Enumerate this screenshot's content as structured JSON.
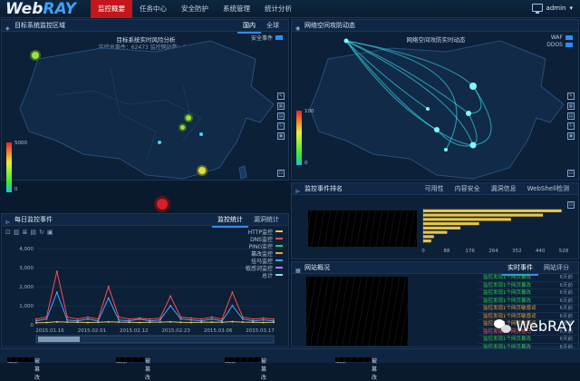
{
  "brand": {
    "web": "Web",
    "ray": "RAY"
  },
  "nav": [
    {
      "label": "监控概要",
      "active": true
    },
    {
      "label": "任务中心"
    },
    {
      "label": "安全防护"
    },
    {
      "label": "系统管理"
    },
    {
      "label": "统计分析"
    }
  ],
  "user": {
    "name": "admin"
  },
  "map_panel": {
    "title": "目标系统监控区域",
    "tabs": [
      {
        "label": "国内",
        "active": true
      },
      {
        "label": "全球"
      }
    ],
    "subtitle": "目标系统实时风险分析",
    "stats": "监控总事件：62473    监控网站数：305",
    "legend": "安全事件",
    "scale_max": "5000",
    "scale_min": "0",
    "legend_color": "#2f8cff"
  },
  "attack_panel": {
    "title": "网络空间攻防动态",
    "subtitle": "网络空间攻防实时动态",
    "legend": [
      {
        "label": "WAF",
        "color": "#2f8cff"
      },
      {
        "label": "DDOS",
        "color": "#2f8cff"
      }
    ],
    "scale_max": "100",
    "scale_min": "0"
  },
  "daily_panel": {
    "title": "每日监控事件",
    "tabs": [
      {
        "label": "监控统计",
        "active": true
      },
      {
        "label": "漏洞统计"
      }
    ],
    "legend": [
      "HTTP监控",
      "DNS监控",
      "PING监控",
      "篡改监控",
      "挂马监控",
      "敏感词监控",
      "总计"
    ],
    "chart_data": {
      "type": "line",
      "y_ticks": [
        "4,000",
        "3,000",
        "2,000",
        "1,000",
        "0"
      ],
      "ylim": [
        0,
        4000
      ],
      "x_ticks": [
        "2015.01.16",
        "2015.02.01",
        "2015.02.12",
        "2015.02.23",
        "2015.03.06",
        "2015.03.17"
      ],
      "series": [
        {
          "name": "HTTP监控",
          "color": "#4aa3ff",
          "values": [
            200,
            300,
            1700,
            250,
            200,
            300,
            200,
            1400,
            250,
            200,
            300,
            200,
            250,
            1000,
            300,
            250,
            200,
            300,
            200,
            1000,
            300,
            200,
            250,
            200
          ]
        },
        {
          "name": "DNS监控",
          "color": "#ff4d4d",
          "values": [
            300,
            400,
            2800,
            400,
            300,
            400,
            300,
            2000,
            400,
            300,
            350,
            300,
            350,
            1500,
            400,
            350,
            300,
            400,
            300,
            1700,
            400,
            300,
            350,
            300
          ]
        },
        {
          "name": "总计",
          "color": "#e8c548",
          "values": [
            100,
            120,
            150,
            140,
            130,
            120,
            130,
            150,
            140,
            130,
            120,
            130,
            140,
            150,
            130,
            120,
            130,
            140,
            130,
            160,
            140,
            130,
            120,
            130
          ]
        }
      ]
    }
  },
  "rank_panel": {
    "title": "监控事件排名",
    "tabs": [
      {
        "label": "可用性"
      },
      {
        "label": "内容安全"
      },
      {
        "label": "漏洞信息"
      },
      {
        "label": "WebShell检测"
      }
    ],
    "chart_data": {
      "type": "bar",
      "categories": [
        "",
        "",
        "",
        "",
        "",
        "",
        "",
        ""
      ],
      "values": [
        520,
        450,
        330,
        210,
        140,
        90,
        40,
        30
      ],
      "x_ticks": [
        "0",
        "88",
        "176",
        "264",
        "352",
        "440",
        "528"
      ],
      "xlim": [
        0,
        528
      ]
    }
  },
  "news_panel": {
    "title": "网站概况",
    "tabs": [
      {
        "label": "实时事件",
        "active": true
      },
      {
        "label": "网站评分"
      }
    ],
    "events": [
      {
        "text": "监控发现1个网页篡改",
        "time": "6天前",
        "color": "#37c85c"
      },
      {
        "text": "监控发现1个网页篡改",
        "time": "6天前",
        "color": "#37c85c"
      },
      {
        "text": "监控发现1个网页篡改",
        "time": "6天前",
        "color": "#37c85c"
      },
      {
        "text": "监控发现1个网页篡改",
        "time": "6天前",
        "color": "#37c85c"
      },
      {
        "text": "监控发现1个网页敏感词",
        "time": "6天前",
        "color": "#e8a23c"
      },
      {
        "text": "监控发现1个网页敏感词",
        "time": "6天前",
        "color": "#e8a23c"
      },
      {
        "text": "监控发现1个网页敏感词",
        "time": "6天前",
        "color": "#e8a23c"
      },
      {
        "text": "监控发现1个网页挂马",
        "time": "6天前",
        "color": "#ff5a5a"
      },
      {
        "text": "监控发现1个网页篡改",
        "time": "6天前",
        "color": "#37c85c"
      },
      {
        "text": "监控发现1个网页篡改",
        "time": "6天前",
        "color": "#37c85c"
      }
    ]
  },
  "watermark": "WebRAY",
  "footer": [
    {
      "text": "站点",
      "tail": "被篡改"
    },
    {
      "text": "站点",
      "tail": "被篡改"
    },
    {
      "text": "站点",
      "tail": "被篡改"
    },
    {
      "text": "站点",
      "tail": "被篡改"
    }
  ]
}
